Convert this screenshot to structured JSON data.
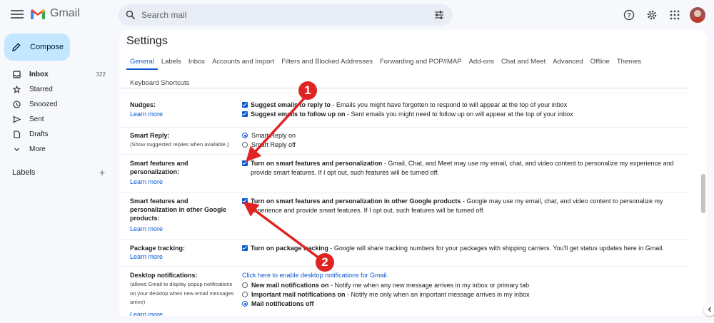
{
  "app": {
    "name": "Gmail"
  },
  "search": {
    "placeholder": "Search mail"
  },
  "sidebar": {
    "compose": "Compose",
    "items": [
      {
        "label": "Inbox",
        "count": "322"
      },
      {
        "label": "Starred"
      },
      {
        "label": "Snoozed"
      },
      {
        "label": "Sent"
      },
      {
        "label": "Drafts"
      },
      {
        "label": "More"
      }
    ],
    "labels_heading": "Labels"
  },
  "settings": {
    "title": "Settings",
    "tabs_row1": [
      "General",
      "Labels",
      "Inbox",
      "Accounts and Import",
      "Filters and Blocked Addresses",
      "Forwarding and POP/IMAP",
      "Add-ons",
      "Chat and Meet",
      "Advanced",
      "Offline",
      "Themes"
    ],
    "tabs_row2": [
      "Keyboard Shortcuts"
    ],
    "learn_more": "Learn more",
    "nudges": {
      "label": "Nudges:",
      "opt1_bold": "Suggest emails to reply to",
      "opt1_text": " - Emails you might have forgotten to respond to will appear at the top of your inbox",
      "opt2_bold": "Suggest emails to follow up on",
      "opt2_text": " - Sent emails you might need to follow up on will appear at the top of your inbox"
    },
    "smart_reply": {
      "label": "Smart Reply:",
      "sub": "(Show suggested replies when available.)",
      "on": "Smart Reply on",
      "off": "Smart Reply off"
    },
    "smart_features": {
      "label": "Smart features and personalization:",
      "bold": "Turn on smart features and personalization",
      "text": " - Gmail, Chat, and Meet may use my email, chat, and video content to personalize my experience and provide smart features. If I opt out, such features will be turned off."
    },
    "smart_other": {
      "label": "Smart features and personalization in other Google products:",
      "bold": "Turn on smart features and personalization in other Google products",
      "text": " - Google may use my email, chat, and video content to personalize my experience and provide smart features. If I opt out, such features will be turned off."
    },
    "package": {
      "label": "Package tracking:",
      "bold": "Turn on package tracking",
      "text": " - Google will share tracking numbers for your packages with shipping carriers. You'll get status updates here in Gmail."
    },
    "desktop": {
      "label": "Desktop notifications:",
      "sub": "(allows Gmail to display popup notifications on your desktop when new email messages arrive)",
      "enable_link": "Click here to enable desktop notifications for Gmail.",
      "opt1_bold": "New mail notifications on",
      "opt1_text": " - Notify me when any new message arrives in my inbox or primary tab",
      "opt2_bold": "Important mail notifications on",
      "opt2_text": " - Notify me only when an important message arrives in my inbox",
      "opt3_bold": "Mail notifications off"
    }
  },
  "annotations": {
    "badge1": "1",
    "badge2": "2",
    "color": "#e02424"
  }
}
